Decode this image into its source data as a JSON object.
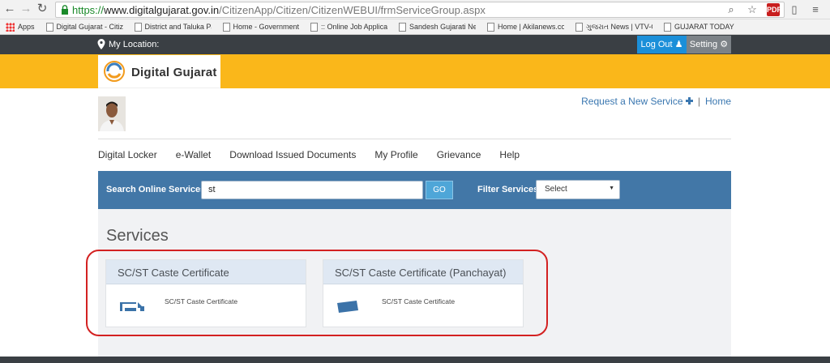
{
  "browser": {
    "url_scheme": "https://",
    "url_host": "www.digitalgujarat.gov.in",
    "url_path": "/CitizenApp/Citizen/CitizenWEBUI/frmServiceGroup.aspx",
    "pdf_icon_text": "PDF"
  },
  "bookmarks": [
    {
      "label": "Apps",
      "icon": "apps-icon"
    },
    {
      "label": "Digital Gujarat - Citize",
      "icon": "page-icon"
    },
    {
      "label": "District and Taluka Pa",
      "icon": "page-icon"
    },
    {
      "label": "Home - Government",
      "icon": "page-icon"
    },
    {
      "label": ":: Online Job Applicati",
      "icon": "page-icon"
    },
    {
      "label": "Sandesh Gujarati New",
      "icon": "page-icon"
    },
    {
      "label": "Home | Akilanews.con",
      "icon": "page-icon"
    },
    {
      "label": "ગુજરાત News | VTV-G",
      "icon": "page-icon"
    },
    {
      "label": "GUJARAT TODAY",
      "icon": "page-icon"
    }
  ],
  "topbar": {
    "location_label": "My Location:",
    "logout_label": "Log Out",
    "setting_label": "Setting"
  },
  "brand": {
    "name": "Digital Gujarat"
  },
  "header_links": {
    "request_label": "Request a New Service",
    "separator": "|",
    "home_label": "Home"
  },
  "nav": [
    "Digital Locker",
    "e-Wallet",
    "Download Issued Documents",
    "My Profile",
    "Grievance",
    "Help"
  ],
  "search": {
    "label": "Search Online Services",
    "value": "st",
    "go_label": "GO",
    "filter_label": "Filter Services",
    "filter_value": "Select"
  },
  "services": {
    "title": "Services",
    "cards": [
      {
        "title": "SC/ST Caste Certificate",
        "desc": "SC/ST Caste Certificate"
      },
      {
        "title": "SC/ST Caste Certificate (Panchayat)",
        "desc": "SC/ST Caste Certificate"
      }
    ]
  },
  "colors": {
    "banner": "#fab71a",
    "topbar": "#3a3f44",
    "search_bar": "#4277a7",
    "logout": "#1b8fd9",
    "highlight": "#d32121"
  }
}
